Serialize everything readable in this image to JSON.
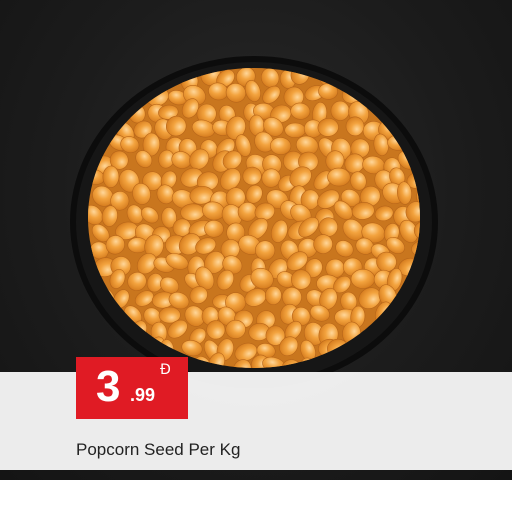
{
  "product": {
    "name": "Popcorn Seed Per Kg",
    "price_main": "3",
    "price_decimal": ".99",
    "currency_symbol": "Ð"
  },
  "colors": {
    "badge": "#e01b24",
    "band": "#f4f4f4",
    "background": "#1a1a1a"
  }
}
